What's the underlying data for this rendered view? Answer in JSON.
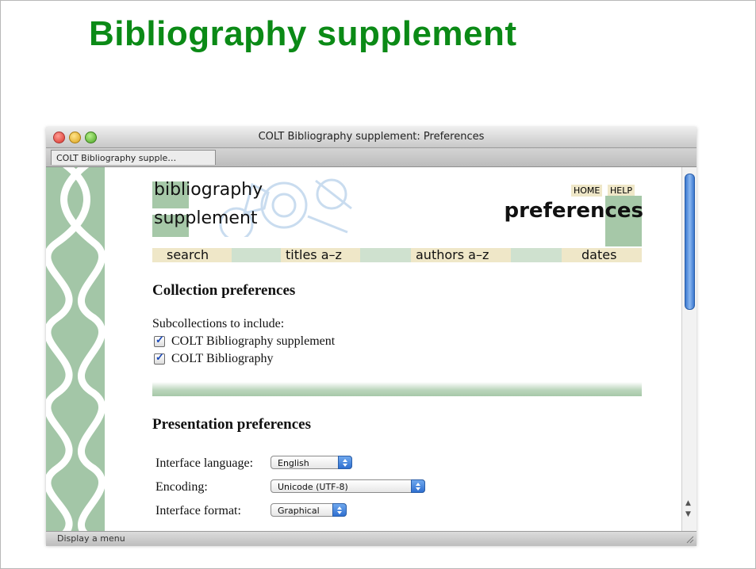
{
  "slide": {
    "title": "Bibliography supplement"
  },
  "window": {
    "title": "COLT Bibliography supplement: Preferences",
    "tab": "COLT Bibliography supple…",
    "status": "Display a menu"
  },
  "page": {
    "logo": {
      "line1": "bibliography",
      "line2": "supplement"
    },
    "links": {
      "home": "HOME",
      "help": "HELP"
    },
    "heading": "preferences",
    "nav": [
      "search",
      "titles a–z",
      "authors a–z",
      "dates"
    ],
    "collection": {
      "heading": "Collection preferences",
      "subtitle": "Subcollections to include:",
      "items": [
        {
          "label": "COLT Bibliography supplement",
          "checked": true
        },
        {
          "label": "COLT Bibliography",
          "checked": true
        }
      ]
    },
    "presentation": {
      "heading": "Presentation preferences",
      "fields": [
        {
          "label": "Interface language:",
          "value": "English"
        },
        {
          "label": "Encoding:",
          "value": "Unicode (UTF-8)"
        },
        {
          "label": "Interface format:",
          "value": "Graphical"
        }
      ]
    }
  },
  "colors": {
    "title_green": "#0b8a16",
    "sage": "#a6c8a8",
    "beige": "#efe7c8"
  }
}
